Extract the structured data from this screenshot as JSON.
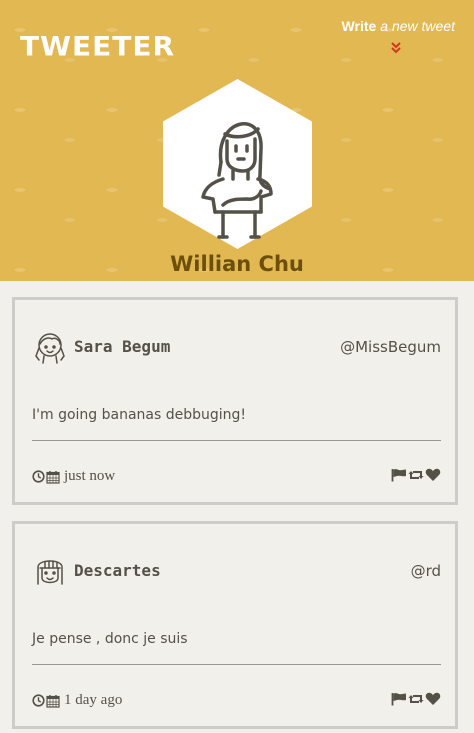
{
  "header": {
    "logo": "TWEETER",
    "write_label": "Write",
    "write_rest": "a new tweet",
    "chevron_color": "#d1381e"
  },
  "profile": {
    "name": "Willian Chu",
    "avatar_icon": "girl-avatar-icon"
  },
  "tweets": [
    {
      "author": "Sara Begum",
      "handle": "@MissBegum",
      "text": "I'm going bananas debbuging!",
      "time": "just now",
      "avatar_icon": "girl-braids-avatar-icon"
    },
    {
      "author": "Descartes",
      "handle": "@rd",
      "text": "Je pense , donc je suis",
      "time": "1 day ago",
      "avatar_icon": "girl-bangs-avatar-icon"
    }
  ],
  "colors": {
    "header_bg": "#e2b852",
    "name": "#6d4f0c",
    "text": "#545149",
    "card_border": "#cecccb",
    "page_bg": "#f2f0eb"
  }
}
